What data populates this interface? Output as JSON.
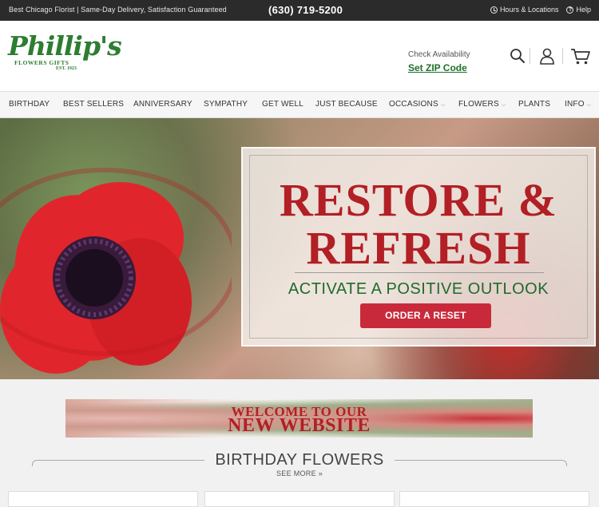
{
  "topbar": {
    "tagline": "Best Chicago Florist | Same-Day Delivery, Satisfaction Guaranteed",
    "phone": "(630) 719-5200",
    "hours_label": "Hours & Locations",
    "help_label": "Help"
  },
  "header": {
    "logo": {
      "name": "Phillip's",
      "sub": "FLOWERS  GIFTS",
      "est": "EST. 1923"
    },
    "zip_label": "Check Availability",
    "zip_link": "Set ZIP Code",
    "icons": [
      "search-icon",
      "account-icon",
      "cart-icon"
    ]
  },
  "nav": {
    "items": [
      {
        "label": "BIRTHDAY",
        "dropdown": false
      },
      {
        "label": "BEST SELLERS",
        "dropdown": false
      },
      {
        "label": "ANNIVERSARY",
        "dropdown": false
      },
      {
        "label": "SYMPATHY",
        "dropdown": false
      },
      {
        "label": "GET WELL",
        "dropdown": false
      },
      {
        "label": "JUST BECAUSE",
        "dropdown": false
      },
      {
        "label": "OCCASIONS",
        "dropdown": true
      },
      {
        "label": "FLOWERS",
        "dropdown": true
      },
      {
        "label": "PLANTS",
        "dropdown": false
      },
      {
        "label": "INFO",
        "dropdown": true
      }
    ]
  },
  "hero": {
    "title_line1": "RESTORE &",
    "title_line2": "REFRESH",
    "subtitle": "ACTIVATE A POSITIVE OUTLOOK",
    "button": "ORDER A RESET"
  },
  "welcome_banner": {
    "line1": "WELCOME TO OUR",
    "line2": "NEW WEBSITE"
  },
  "section": {
    "title": "BIRTHDAY FLOWERS",
    "see_more": "SEE MORE »"
  },
  "colors": {
    "brand_green": "#2e7d32",
    "accent_red": "#b21f24",
    "button_red": "#c92a3b",
    "topbar": "#2b2b2b"
  }
}
